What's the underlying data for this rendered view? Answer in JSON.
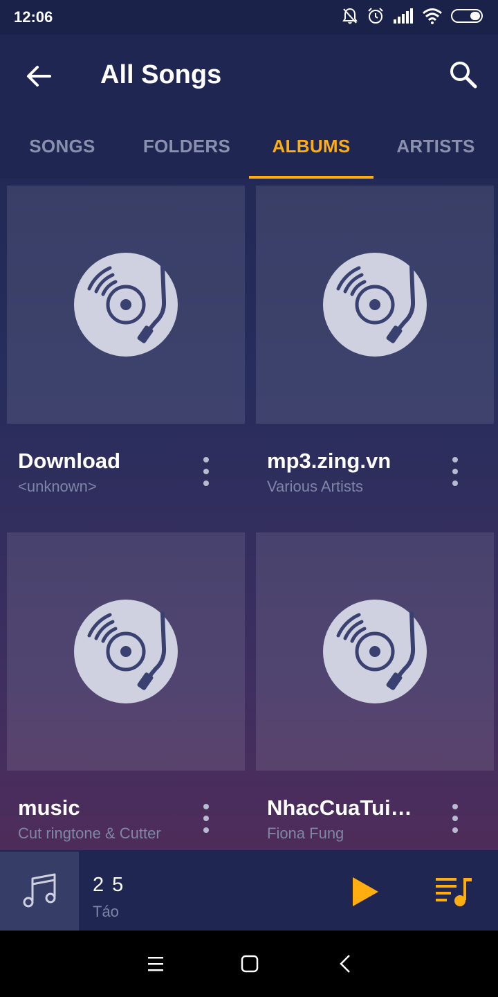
{
  "status_bar": {
    "time": "12:06",
    "icons": [
      "bell-off-icon",
      "alarm-icon",
      "signal-icon",
      "wifi-icon",
      "battery-icon"
    ]
  },
  "app_bar": {
    "title": "All Songs",
    "back_icon": "arrow-left-icon",
    "search_icon": "search-icon"
  },
  "tabs": [
    {
      "label": "SONGS",
      "active": false
    },
    {
      "label": "FOLDERS",
      "active": false
    },
    {
      "label": "ALBUMS",
      "active": true
    },
    {
      "label": "ARTISTS",
      "active": false
    }
  ],
  "albums": [
    {
      "title": "Download",
      "subtitle": "<unknown>",
      "icon": "vinyl-turntable-icon"
    },
    {
      "title": "mp3.zing.vn",
      "subtitle": "Various Artists",
      "icon": "vinyl-turntable-icon"
    },
    {
      "title": "music",
      "subtitle": "Cut ringtone & Cutter",
      "icon": "vinyl-turntable-icon"
    },
    {
      "title": "NhacCuaTui.com",
      "subtitle": "Fiona Fung",
      "icon": "vinyl-turntable-icon"
    }
  ],
  "mini_player": {
    "title": "2 5",
    "artist": "Táo",
    "art_icon": "music-note-icon",
    "play_icon": "play-icon",
    "queue_icon": "playlist-icon"
  },
  "nav_bar": {
    "icons": [
      "menu-icon",
      "home-icon",
      "back-icon"
    ]
  },
  "colors": {
    "accent": "#ffae12",
    "bar_background": "#1f2651",
    "muted_text": "#7f86a7"
  }
}
